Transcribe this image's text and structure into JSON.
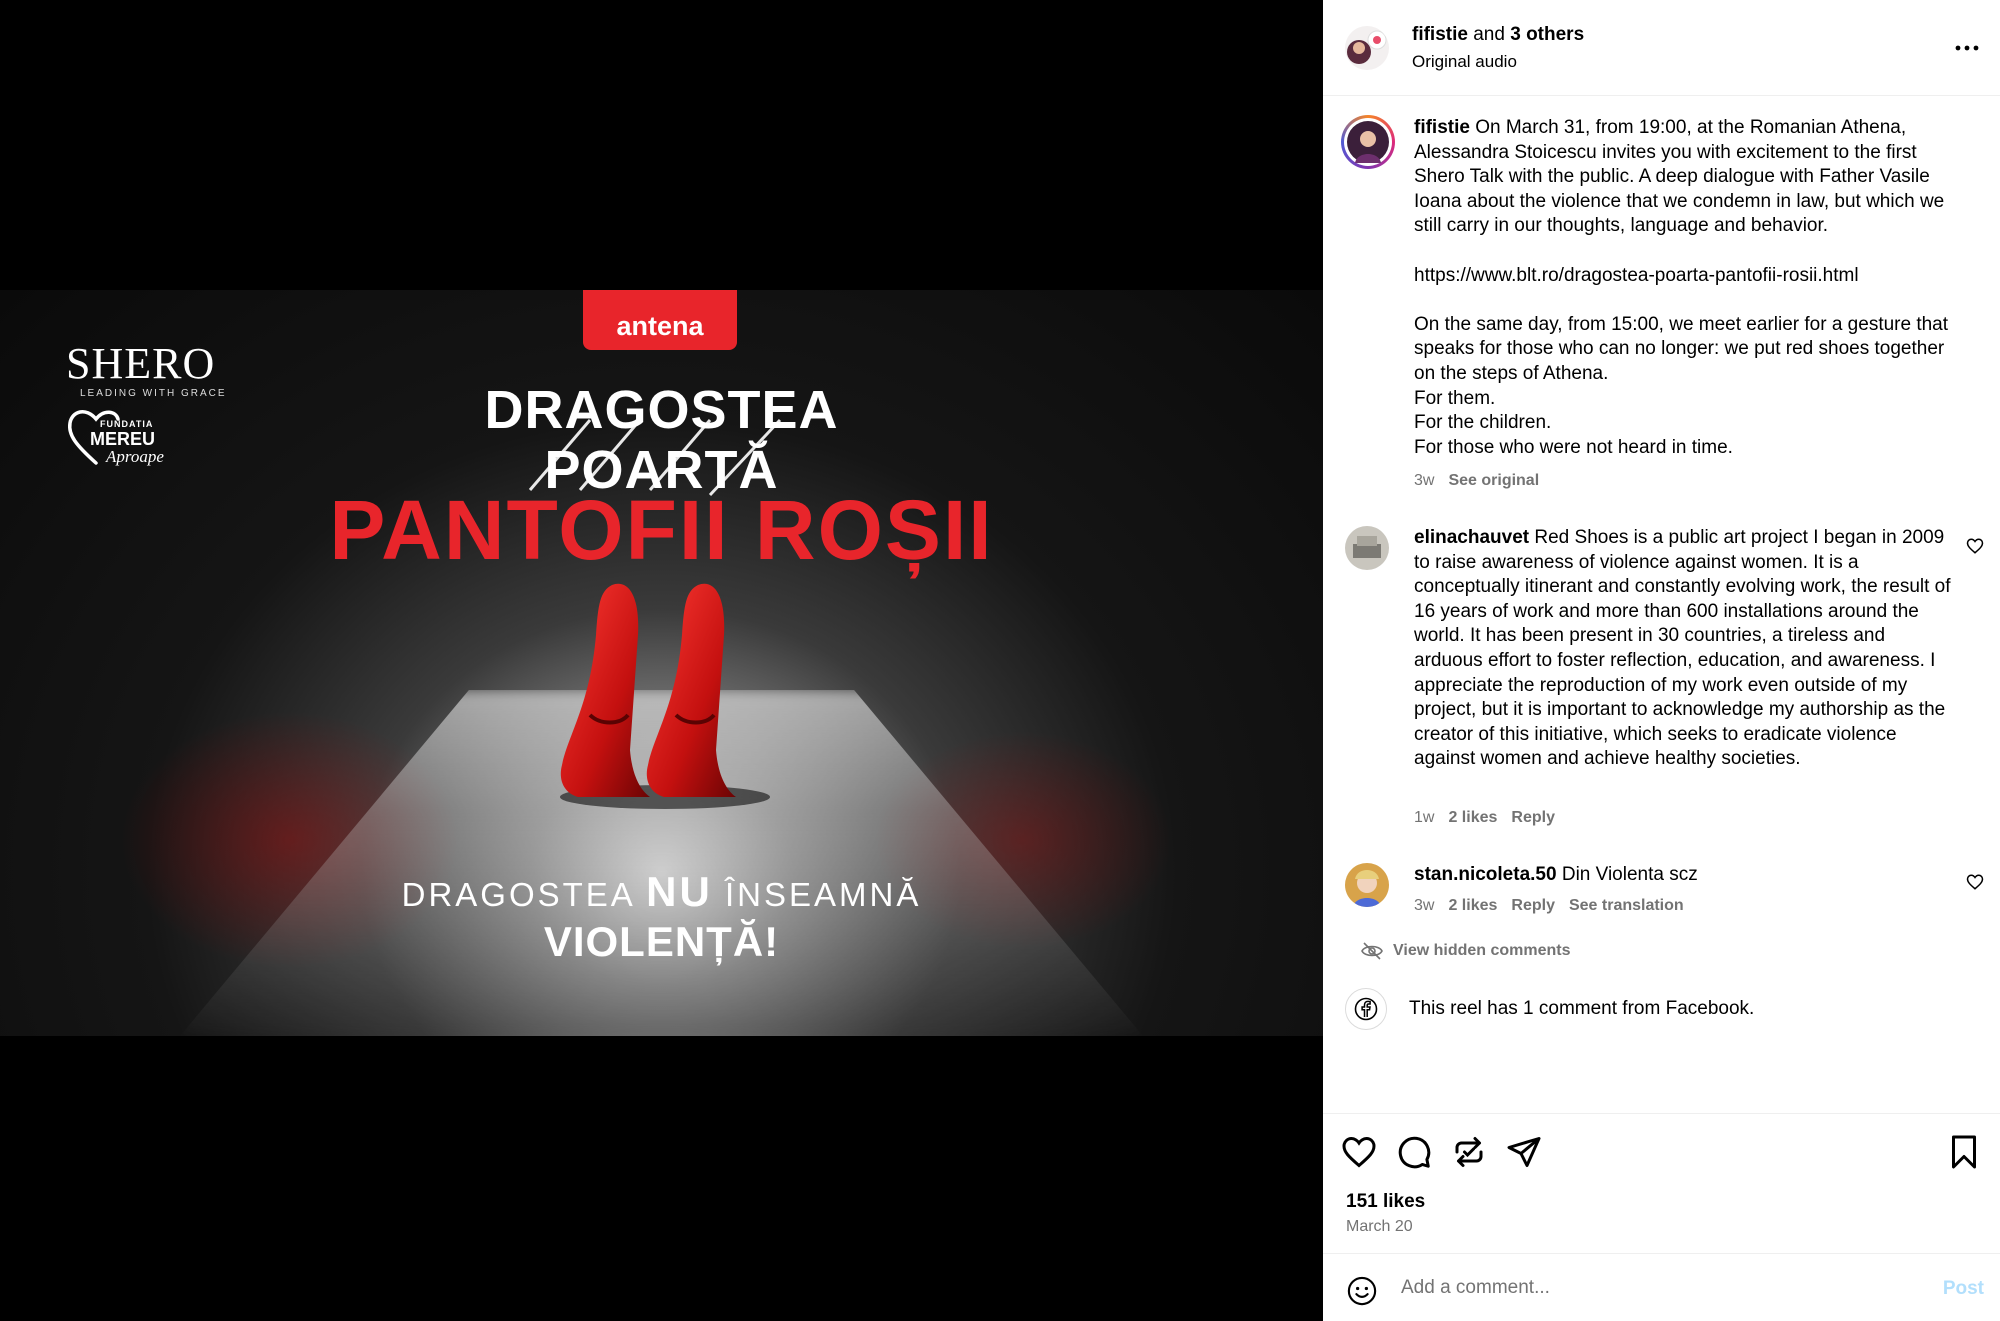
{
  "video": {
    "badge": "antena",
    "shero_word": "SHERO",
    "shero_tag": "LEADING WITH GRACE",
    "fundatia_l1": "FUNDATIA",
    "fundatia_l2": "MEREU",
    "fundatia_l3": "Aproape",
    "title_line1": "DRAGOSTEA",
    "title_line2": "POARTĂ",
    "title_main": "PANTOFII ROȘII",
    "slogan_pre": "DRAGOSTEA ",
    "slogan_bold": "NU",
    "slogan_post": " ÎNSEAMNĂ",
    "slogan_line2": "VIOLENȚĂ!"
  },
  "header": {
    "username": "fifistie",
    "and_text": " and ",
    "others": "3 others",
    "audio": "Original audio"
  },
  "caption": {
    "username": "fifistie",
    "text": " On March 31, from 19:00, at the Romanian Athena, Alessandra Stoicescu invites you with excitement to the first Shero Talk with the public. A deep dialogue with Father Vasile Ioana about the violence that we condemn in law, but which we still carry in our thoughts, language and behavior.\n\nhttps://www.blt.ro/dragostea-poarta-pantofii-rosii.html\n\nOn the same day, from 15:00, we meet earlier for a gesture that speaks for those who can no longer: we put red shoes together on the steps of Athena.\nFor them.\nFor the children.\nFor those who were not heard in time.",
    "time": "3w",
    "see_original": "See original"
  },
  "comments": [
    {
      "username": "elinachauvet",
      "text": " Red Shoes is a public art project I began in 2009 to raise awareness of violence against women. It is a conceptually itinerant and constantly evolving work, the result of 16 years of work and more than 600 installations around the world. It has been present in 30 countries, a tireless and arduous effort to foster reflection, education, and awareness. I appreciate the reproduction of my work even outside of my project, but it is important to acknowledge my authorship as the creator of this initiative, which seeks to eradicate violence against women and achieve healthy societies.",
      "time": "1w",
      "likes": "2 likes",
      "reply": "Reply"
    },
    {
      "username": "stan.nicoleta.50",
      "text": " Din Violenta scz",
      "time": "3w",
      "likes": "2 likes",
      "reply": "Reply",
      "translation": "See translation"
    }
  ],
  "hidden_comments": "View hidden comments",
  "facebook_note": "This reel has 1 comment from Facebook.",
  "likes": "151 likes",
  "date": "March 20",
  "comment_input": {
    "placeholder": "Add a comment..."
  },
  "post_label": "Post",
  "colors": {
    "accent_red": "#e8252b",
    "post_disabled": "#b2dffc",
    "meta_gray": "#737373"
  }
}
